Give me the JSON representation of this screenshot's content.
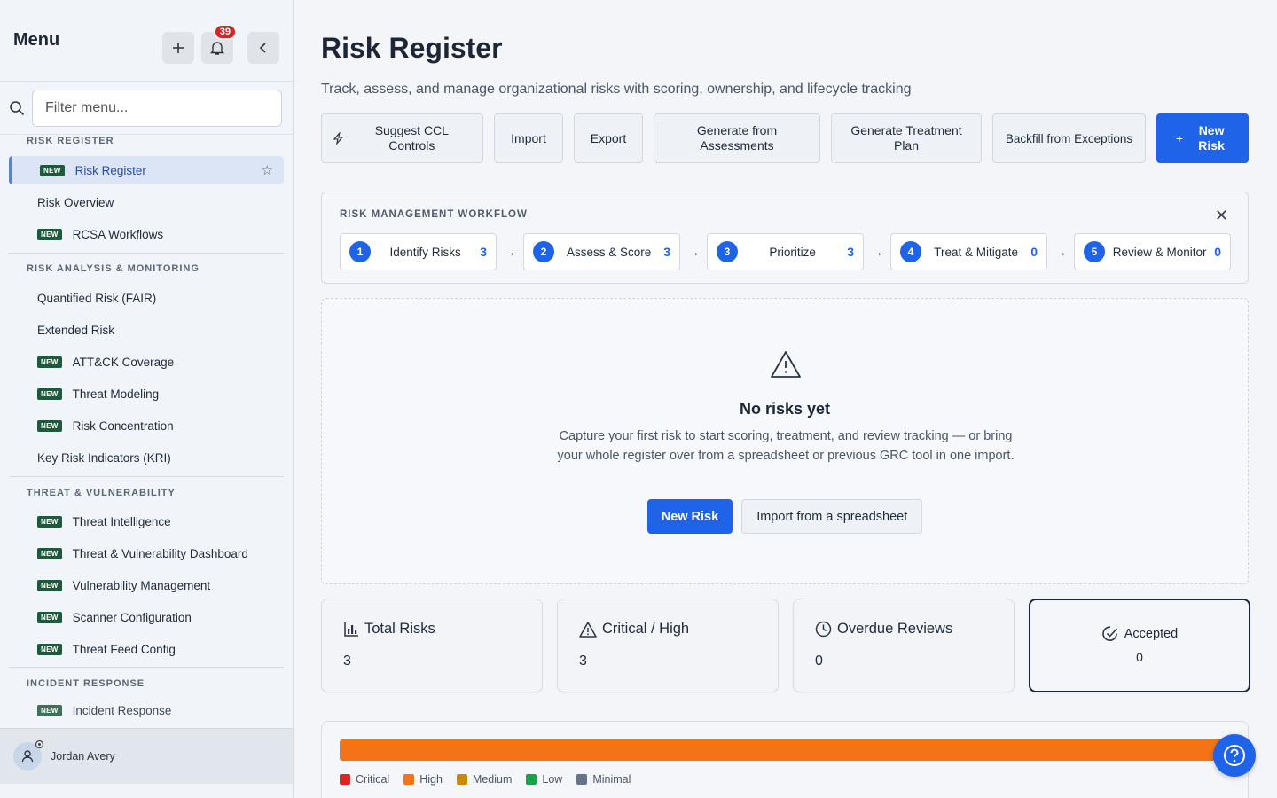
{
  "sidebar": {
    "title": "Menu",
    "notification_count": "39",
    "filter_placeholder": "Filter menu...",
    "new_tag": "NEW",
    "groups": [
      {
        "title": "RISK REGISTER",
        "items": [
          {
            "label": "Risk Register",
            "new": true,
            "active": true
          },
          {
            "label": "Risk Overview",
            "new": false
          },
          {
            "label": "RCSA Workflows",
            "new": true
          }
        ]
      },
      {
        "title": "RISK ANALYSIS & MONITORING",
        "items": [
          {
            "label": "Quantified Risk (FAIR)",
            "new": false
          },
          {
            "label": "Extended Risk",
            "new": false
          },
          {
            "label": "ATT&CK Coverage",
            "new": true
          },
          {
            "label": "Threat Modeling",
            "new": true
          },
          {
            "label": "Risk Concentration",
            "new": true
          },
          {
            "label": "Key Risk Indicators (KRI)",
            "new": false
          }
        ]
      },
      {
        "title": "THREAT & VULNERABILITY",
        "items": [
          {
            "label": "Threat Intelligence",
            "new": true
          },
          {
            "label": "Threat & Vulnerability Dashboard",
            "new": true
          },
          {
            "label": "Vulnerability Management",
            "new": true
          },
          {
            "label": "Scanner Configuration",
            "new": true
          },
          {
            "label": "Threat Feed Config",
            "new": true
          }
        ]
      },
      {
        "title": "INCIDENT RESPONSE",
        "items": [
          {
            "label": "Incident Response",
            "new": true
          }
        ]
      }
    ],
    "user_name": "Jordan Avery"
  },
  "main": {
    "title": "Risk Register",
    "subtitle": "Track, assess, and manage organizational risks with scoring, ownership, and lifecycle tracking",
    "actions": {
      "suggest": "Suggest CCL Controls",
      "import": "Import",
      "export": "Export",
      "generate_assess": "Generate from Assessments",
      "generate_treat": "Generate Treatment Plan",
      "backfill": "Backfill from Exceptions",
      "new_risk": "New Risk"
    },
    "workflow": {
      "title": "RISK MANAGEMENT WORKFLOW",
      "steps": [
        {
          "num": "1",
          "label": "Identify Risks",
          "count": "3"
        },
        {
          "num": "2",
          "label": "Assess & Score",
          "count": "3"
        },
        {
          "num": "3",
          "label": "Prioritize",
          "count": "3"
        },
        {
          "num": "4",
          "label": "Treat & Mitigate",
          "count": "0"
        },
        {
          "num": "5",
          "label": "Review & Monitor",
          "count": "0"
        }
      ]
    },
    "empty": {
      "title": "No risks yet",
      "text": "Capture your first risk to start scoring, treatment, and review tracking — or bring your whole register over from a spreadsheet or previous GRC tool in one import.",
      "primary": "New Risk",
      "secondary": "Import from a spreadsheet"
    },
    "stats": [
      {
        "label": "Total Risks",
        "value": "3"
      },
      {
        "label": "Critical / High",
        "value": "3"
      },
      {
        "label": "Overdue Reviews",
        "value": "0"
      },
      {
        "label": "Accepted",
        "value": "0"
      }
    ],
    "distribution": {
      "legend": [
        {
          "label": "Critical",
          "color": "#dc2626"
        },
        {
          "label": "High",
          "color": "#f47316"
        },
        {
          "label": "Medium",
          "color": "#ca8a04"
        },
        {
          "label": "Low",
          "color": "#16a34a"
        },
        {
          "label": "Minimal",
          "color": "#64748b"
        }
      ],
      "bar_color": "#f47316"
    }
  }
}
